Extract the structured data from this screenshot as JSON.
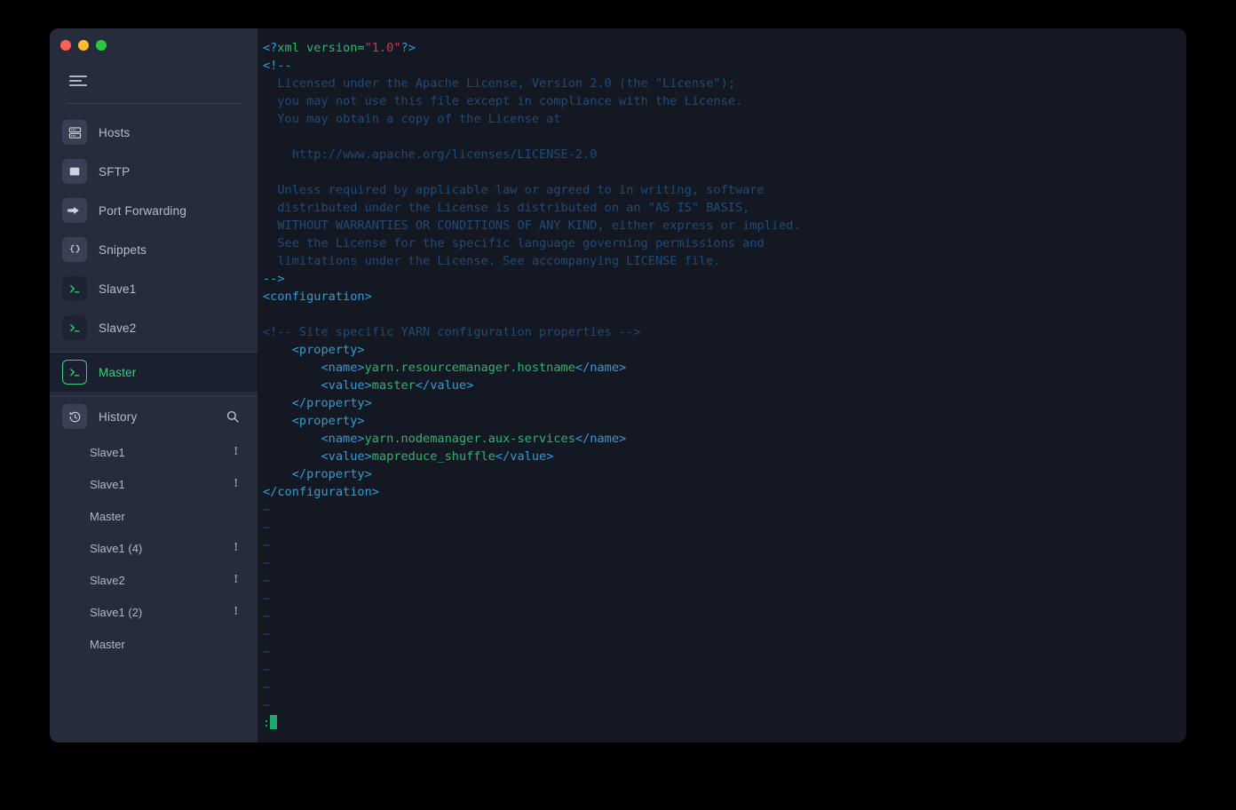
{
  "window": {
    "traffic_lights": [
      "close",
      "minimize",
      "maximize"
    ],
    "colors": {
      "sidebar_bg": "#272c3c",
      "terminal_bg": "#141822",
      "accent_green": "#35d07f",
      "tag_blue": "#2f9dd6",
      "comment_blue": "#1f4b79",
      "string_red": "#c8385a",
      "text_green": "#2bb673"
    }
  },
  "sidebar": {
    "menu_button": "menu",
    "items": [
      {
        "label": "Hosts",
        "icon": "server-icon",
        "active": false
      },
      {
        "label": "SFTP",
        "icon": "folder-icon",
        "active": false
      },
      {
        "label": "Port Forwarding",
        "icon": "port-forward-icon",
        "active": false
      },
      {
        "label": "Snippets",
        "icon": "braces-icon",
        "active": false
      },
      {
        "label": "Slave1",
        "icon": "terminal-icon",
        "active": false
      },
      {
        "label": "Slave2",
        "icon": "terminal-icon",
        "active": false
      },
      {
        "label": "Master",
        "icon": "terminal-icon",
        "active": true
      }
    ],
    "history": {
      "title": "History",
      "icon": "history-icon",
      "search_icon": "search-icon",
      "items": [
        {
          "label": "Slave1",
          "badge": "!"
        },
        {
          "label": "Slave1",
          "badge": "!"
        },
        {
          "label": "Master",
          "badge": ""
        },
        {
          "label": "Slave1 (4)",
          "badge": "!"
        },
        {
          "label": "Slave2",
          "badge": "!"
        },
        {
          "label": "Slave1 (2)",
          "badge": "!"
        },
        {
          "label": "Master",
          "badge": ""
        }
      ]
    }
  },
  "terminal": {
    "editor": "vim",
    "filetype": "xml",
    "status_prompt": ":",
    "tilde_count": 12,
    "lines": [
      [
        {
          "t": "tag",
          "v": "<?"
        },
        {
          "t": "attr",
          "v": "xml version="
        },
        {
          "t": "str",
          "v": "\"1.0\""
        },
        {
          "t": "tag",
          "v": "?>"
        }
      ],
      [
        {
          "t": "tag",
          "v": "<!--"
        }
      ],
      [
        {
          "t": "comment",
          "v": "  Licensed under the Apache License, Version 2.0 (the \"License\");"
        }
      ],
      [
        {
          "t": "comment",
          "v": "  you may not use this file except in compliance with the License."
        }
      ],
      [
        {
          "t": "comment",
          "v": "  You may obtain a copy of the License at"
        }
      ],
      [
        {
          "t": "comment",
          "v": ""
        }
      ],
      [
        {
          "t": "comment",
          "v": "    http://www.apache.org/licenses/LICENSE-2.0"
        }
      ],
      [
        {
          "t": "comment",
          "v": ""
        }
      ],
      [
        {
          "t": "comment",
          "v": "  Unless required by applicable law or agreed to in writing, software"
        }
      ],
      [
        {
          "t": "comment",
          "v": "  distributed under the License is distributed on an \"AS IS\" BASIS,"
        }
      ],
      [
        {
          "t": "comment",
          "v": "  WITHOUT WARRANTIES OR CONDITIONS OF ANY KIND, either express or implied."
        }
      ],
      [
        {
          "t": "comment",
          "v": "  See the License for the specific language governing permissions and"
        }
      ],
      [
        {
          "t": "comment",
          "v": "  limitations under the License. See accompanying LICENSE file."
        }
      ],
      [
        {
          "t": "tag",
          "v": "-->"
        }
      ],
      [
        {
          "t": "tag",
          "v": "<configuration>"
        }
      ],
      [
        {
          "t": "plain",
          "v": ""
        }
      ],
      [
        {
          "t": "comment",
          "v": "<!-- Site specific YARN configuration properties -->"
        }
      ],
      [
        {
          "t": "tag",
          "v": "    <property>"
        }
      ],
      [
        {
          "t": "tag",
          "v": "        <name>"
        },
        {
          "t": "text",
          "v": "yarn.resourcemanager.hostname"
        },
        {
          "t": "tag",
          "v": "</name>"
        }
      ],
      [
        {
          "t": "tag",
          "v": "        <value>"
        },
        {
          "t": "text",
          "v": "master"
        },
        {
          "t": "tag",
          "v": "</value>"
        }
      ],
      [
        {
          "t": "tag",
          "v": "    </property>"
        }
      ],
      [
        {
          "t": "tag",
          "v": "    <property>"
        }
      ],
      [
        {
          "t": "tag",
          "v": "        <name>"
        },
        {
          "t": "text",
          "v": "yarn.nodemanager.aux-services"
        },
        {
          "t": "tag",
          "v": "</name>"
        }
      ],
      [
        {
          "t": "tag",
          "v": "        <value>"
        },
        {
          "t": "text",
          "v": "mapreduce_shuffle"
        },
        {
          "t": "tag",
          "v": "</value>"
        }
      ],
      [
        {
          "t": "tag",
          "v": "    </property>"
        }
      ],
      [
        {
          "t": "tag",
          "v": "</configuration>"
        }
      ]
    ]
  }
}
